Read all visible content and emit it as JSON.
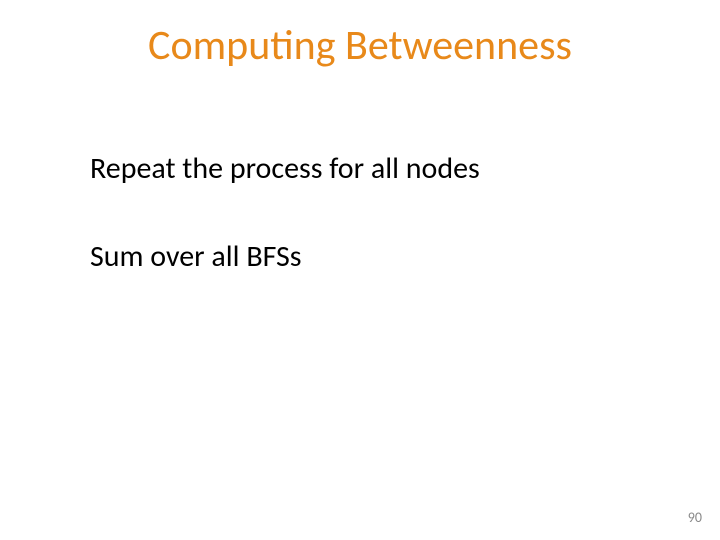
{
  "colors": {
    "title": "#E8891A"
  },
  "title": "Computing Betweenness",
  "body": {
    "line1": "Repeat the process for all nodes",
    "line2": "Sum over all BFSs"
  },
  "page_number": "90"
}
